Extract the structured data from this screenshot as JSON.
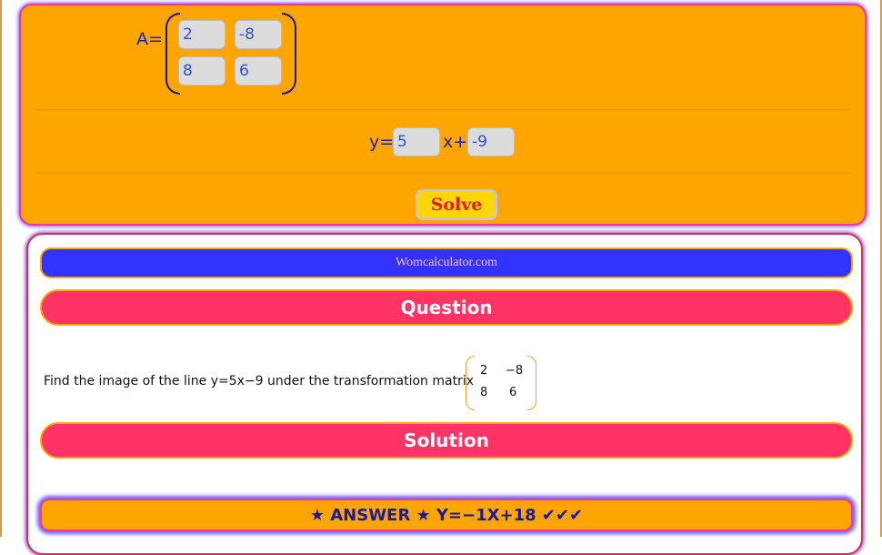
{
  "matrix": {
    "label": "A=",
    "a11": "2",
    "a12": "-8",
    "a21": "8",
    "a22": "6"
  },
  "line": {
    "y_label": "y=",
    "slope": "5",
    "x_label": "x+",
    "intercept": "-9"
  },
  "solve_label": "Solve",
  "result": {
    "site": "Womcalculator.com",
    "question_heading": "Question",
    "question_text": "Find the image of the line y=5x−9 under the transformation matrix",
    "question_matrix": {
      "a11": "2",
      "a12": "−8",
      "a21": "8",
      "a22": "6"
    },
    "solution_heading": "Solution",
    "answer": "★ ANSWER ★ Y=−1X+18 ✔✔✔"
  },
  "colors": {
    "panel": "#ffa500",
    "button": "#ffd700",
    "site_bar": "#3333ff",
    "section_bar": "#ff3366",
    "text_blue": "#2020b0"
  }
}
